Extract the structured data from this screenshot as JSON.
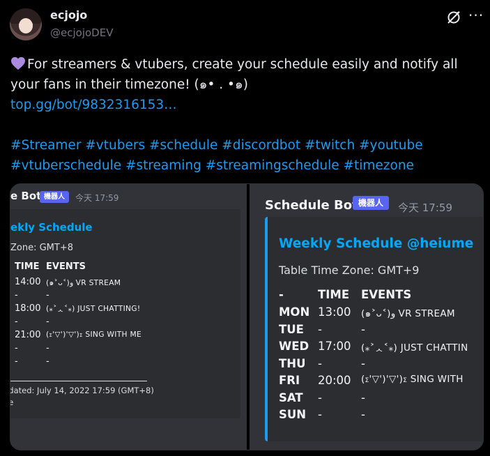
{
  "author": {
    "name": "ecjojo",
    "handle": "@ecjojoDEV"
  },
  "icons": {
    "grok": "grok-icon",
    "more": "more-icon",
    "heart": "purple-heart-icon"
  },
  "tweet": {
    "line1": "For streamers & vtubers, create your schedule easily and notify all",
    "line2": "your fans in their timezone! (๑• . •๑)",
    "link": "top.gg/bot/9832316153…",
    "tags1": "#Streamer #vtubers #schedule #discordbot #twitch #youtube",
    "tags2": "#vtuberschedule #streaming #streamingschedule #timezone"
  },
  "colors": {
    "link": "#1d9bf0",
    "heart": "#a98be0",
    "discord_bg": "#313338",
    "embed_bg": "#2b2d31",
    "badge": "#5865f2"
  },
  "left_panel": {
    "bot_name": "e Bot",
    "badge": "機器人",
    "time": "今天 17:59",
    "embed_title": "ekly Schedule",
    "zone": "Zone: GMT+8",
    "header": {
      "c1": "TIME",
      "c2": "EVENTS"
    },
    "rows": [
      {
        "time": "14:00",
        "event": "(๑˃ᴗ˂)ﻭ VR STREAM"
      },
      {
        "time": "-",
        "event": "-"
      },
      {
        "time": "18:00",
        "event": "(⁎˃ᆺ˂⁎) JUST CHATTING!"
      },
      {
        "time": "-",
        "event": "-"
      },
      {
        "time": "21:00",
        "event": "(σ'▽')'▽')σ SING WITH ME"
      },
      {
        "time": "-",
        "event": "-"
      },
      {
        "time": "-",
        "event": "-"
      }
    ],
    "footer1": "pdated: July 14, 2022 17:59 (GMT+8)",
    "footer2": "ne"
  },
  "right_panel": {
    "bot_name": "Schedule Bot",
    "badge": "機器人",
    "time": "今天 17:59",
    "embed_title": "Weekly Schedule @heiume",
    "zone": "Table Time Zone: GMT+9",
    "header": {
      "c0": "-",
      "c1": "TIME",
      "c2": "EVENTS"
    },
    "rows": [
      {
        "day": "MON",
        "time": "13:00",
        "event": "(๑˃ᴗ˂)ﻭ VR STREAM"
      },
      {
        "day": "TUE",
        "time": "-",
        "event": "-"
      },
      {
        "day": "WED",
        "time": "17:00",
        "event": "(⁎˃ᆺ˂⁎) JUST CHATTIN"
      },
      {
        "day": "THU",
        "time": "-",
        "event": "-"
      },
      {
        "day": "FRI",
        "time": "20:00",
        "event": "(σ'▽')'▽')σ SING WITH"
      },
      {
        "day": "SAT",
        "time": "-",
        "event": "-"
      },
      {
        "day": "SUN",
        "time": "-",
        "event": "-"
      }
    ]
  }
}
